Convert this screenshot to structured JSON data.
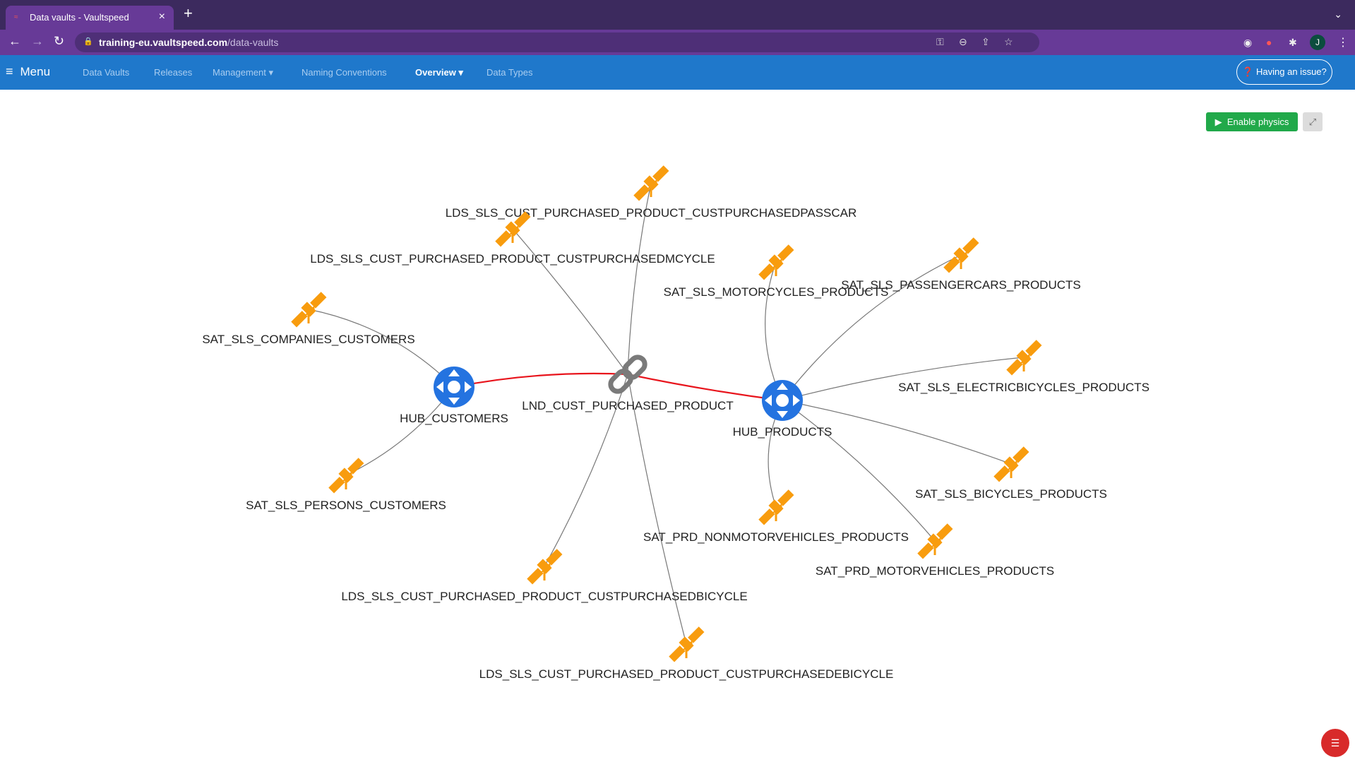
{
  "browser": {
    "tab_title": "Data vaults - Vaultspeed",
    "url_host": "training-eu.vaultspeed.com",
    "url_path": "/data-vaults",
    "profile_initial": "J"
  },
  "appbar": {
    "menu_label": "Menu",
    "nav": [
      {
        "label": "Data Vaults",
        "active": false
      },
      {
        "label": "Releases",
        "active": false
      },
      {
        "label": "Management ▾",
        "active": false
      },
      {
        "label": "Naming Conventions",
        "active": false
      },
      {
        "label": "Overview ▾",
        "active": true
      },
      {
        "label": "Data Types",
        "active": false
      }
    ],
    "issue_button": "Having an issue?"
  },
  "toolbar": {
    "physics_label": "Enable physics"
  },
  "graph": {
    "colors": {
      "hub": "#2473e0",
      "satellite": "#f89c0e",
      "link": "#7a7a7a",
      "hub_link_edge": "#e8141c",
      "edge": "#777777"
    },
    "nodes": [
      {
        "id": "hub_customers",
        "type": "hub",
        "label": "HUB_CUSTOMERS"
      },
      {
        "id": "lnd_link",
        "type": "link",
        "label": "LND_CUST_PURCHASED_PRODUCT"
      },
      {
        "id": "hub_products",
        "type": "hub",
        "label": "HUB_PRODUCTS"
      },
      {
        "id": "lds_passcar",
        "type": "satellite",
        "label": "LDS_SLS_CUST_PURCHASED_PRODUCT_CUSTPURCHASEDPASSCAR"
      },
      {
        "id": "lds_mcycle",
        "type": "satellite",
        "label": "LDS_SLS_CUST_PURCHASED_PRODUCT_CUSTPURCHASEDMCYCLE"
      },
      {
        "id": "sat_motorcycles",
        "type": "satellite",
        "label": "SAT_SLS_MOTORCYCLES_PRODUCTS"
      },
      {
        "id": "sat_passengercars",
        "type": "satellite",
        "label": "SAT_SLS_PASSENGERCARS_PRODUCTS"
      },
      {
        "id": "sat_companies",
        "type": "satellite",
        "label": "SAT_SLS_COMPANIES_CUSTOMERS"
      },
      {
        "id": "sat_electric",
        "type": "satellite",
        "label": "SAT_SLS_ELECTRICBICYCLES_PRODUCTS"
      },
      {
        "id": "sat_persons",
        "type": "satellite",
        "label": "SAT_SLS_PERSONS_CUSTOMERS"
      },
      {
        "id": "sat_bicycles",
        "type": "satellite",
        "label": "SAT_SLS_BICYCLES_PRODUCTS"
      },
      {
        "id": "sat_nonmotor",
        "type": "satellite",
        "label": "SAT_PRD_NONMOTORVEHICLES_PRODUCTS"
      },
      {
        "id": "sat_motorveh",
        "type": "satellite",
        "label": "SAT_PRD_MOTORVEHICLES_PRODUCTS"
      },
      {
        "id": "lds_bicycle",
        "type": "satellite",
        "label": "LDS_SLS_CUST_PURCHASED_PRODUCT_CUSTPURCHASEDBICYCLE"
      },
      {
        "id": "lds_ebicycle",
        "type": "satellite",
        "label": "LDS_SLS_CUST_PURCHASED_PRODUCT_CUSTPURCHASEDEBICYCLE"
      }
    ],
    "edges": [
      {
        "from": "hub_customers",
        "to": "lnd_link",
        "kind": "hub-link"
      },
      {
        "from": "lnd_link",
        "to": "hub_products",
        "kind": "hub-link"
      },
      {
        "from": "lnd_link",
        "to": "lds_passcar",
        "kind": "sat"
      },
      {
        "from": "lnd_link",
        "to": "lds_mcycle",
        "kind": "sat"
      },
      {
        "from": "lnd_link",
        "to": "lds_bicycle",
        "kind": "sat"
      },
      {
        "from": "lnd_link",
        "to": "lds_ebicycle",
        "kind": "sat"
      },
      {
        "from": "hub_customers",
        "to": "sat_companies",
        "kind": "sat"
      },
      {
        "from": "hub_customers",
        "to": "sat_persons",
        "kind": "sat"
      },
      {
        "from": "hub_products",
        "to": "sat_motorcycles",
        "kind": "sat"
      },
      {
        "from": "hub_products",
        "to": "sat_passengercars",
        "kind": "sat"
      },
      {
        "from": "hub_products",
        "to": "sat_electric",
        "kind": "sat"
      },
      {
        "from": "hub_products",
        "to": "sat_bicycles",
        "kind": "sat"
      },
      {
        "from": "hub_products",
        "to": "sat_nonmotor",
        "kind": "sat"
      },
      {
        "from": "hub_products",
        "to": "sat_motorveh",
        "kind": "sat"
      }
    ]
  }
}
